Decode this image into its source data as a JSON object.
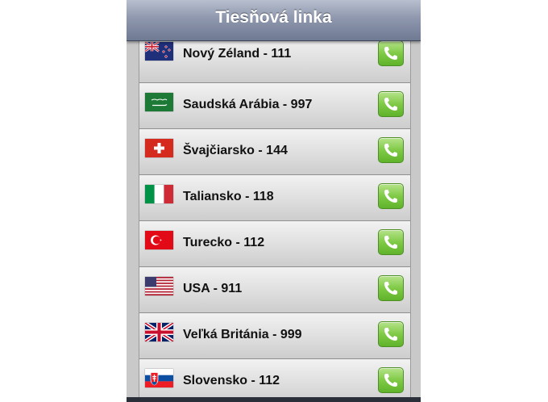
{
  "navbar": {
    "title": "Tiesňová linka"
  },
  "rows": [
    {
      "label": "Nový Zéland - 111",
      "flag": "new-zealand",
      "action_icon": "phone-icon"
    },
    {
      "label": "Saudská Arábia - 997",
      "flag": "saudi-arabia",
      "action_icon": "phone-icon"
    },
    {
      "label": "Švajčiarsko - 144",
      "flag": "switzerland",
      "action_icon": "phone-icon"
    },
    {
      "label": "Taliansko - 118",
      "flag": "italy",
      "action_icon": "phone-icon"
    },
    {
      "label": "Turecko - 112",
      "flag": "turkey",
      "action_icon": "phone-icon"
    },
    {
      "label": "USA - 911",
      "flag": "usa",
      "action_icon": "phone-icon"
    },
    {
      "label": "Veľká Británia - 999",
      "flag": "united-kingdom",
      "action_icon": "phone-icon"
    },
    {
      "label": "Slovensko - 112",
      "flag": "slovakia",
      "action_icon": "phone-icon"
    }
  ],
  "colors": {
    "navbar": "#7f89a1",
    "row": "#dedede",
    "call_button": "#7fca46"
  }
}
